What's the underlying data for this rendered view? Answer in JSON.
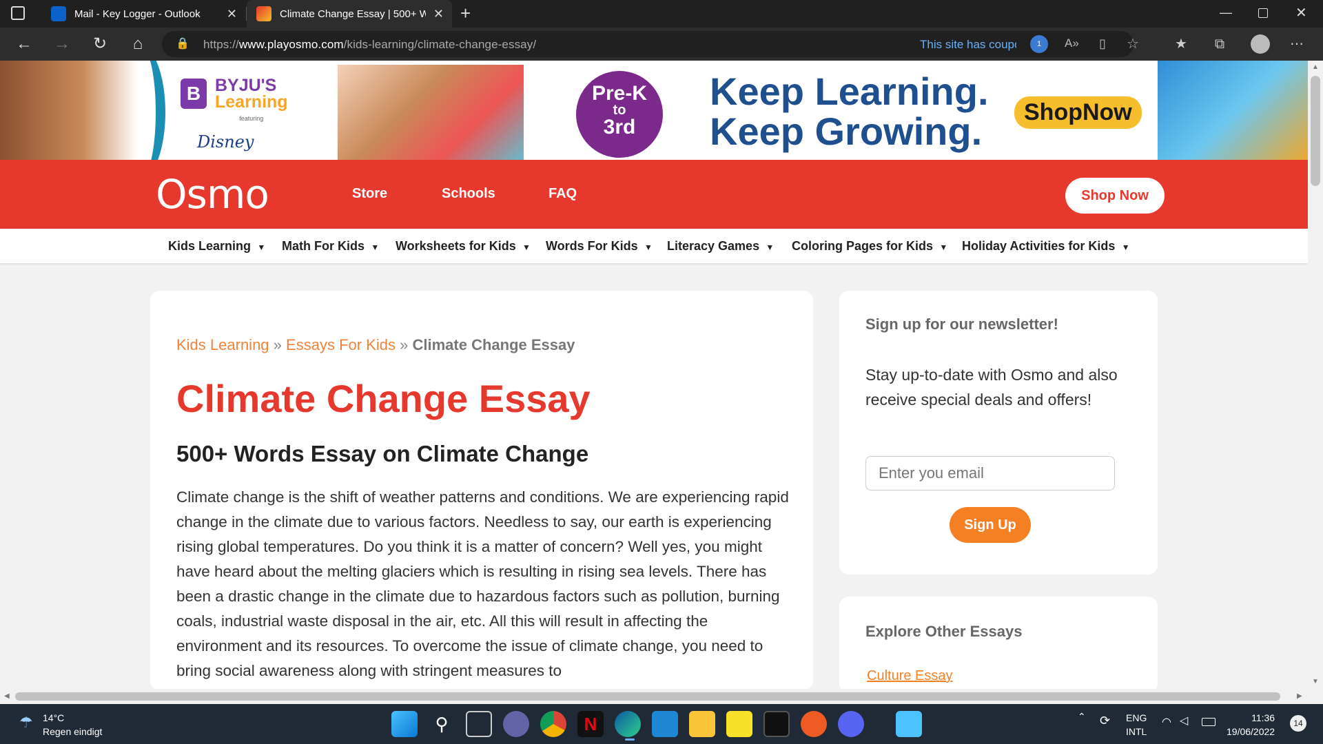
{
  "browser": {
    "tabs": [
      {
        "title": "Mail - Key Logger - Outlook"
      },
      {
        "title": "Climate Change Essay | 500+ Wo"
      }
    ],
    "url_prefix": "https://",
    "url_domain": "www.playosmo.com",
    "url_path": "/kids-learning/climate-change-essay/",
    "coupon_text": "This site has coupc",
    "coupon_count": "1"
  },
  "banner": {
    "brand": "BYJU'S",
    "brand_sub": "Learning",
    "featuring": "featuring",
    "disney": "Disney",
    "grade_top": "Pre-K",
    "grade_mid": "to",
    "grade_bottom": "3rd",
    "tagline1": "Keep Learning.",
    "tagline2": "Keep Growing.",
    "cta": "ShopNow"
  },
  "header": {
    "logo": "Osmo",
    "nav": [
      "Store",
      "Schools",
      "FAQ"
    ],
    "shop_now": "Shop Now"
  },
  "subnav": [
    "Kids Learning",
    "Math For Kids",
    "Worksheets for Kids",
    "Words For Kids",
    "Literacy Games",
    "Coloring Pages for Kids",
    "Holiday Activities for Kids"
  ],
  "article": {
    "breadcrumb": {
      "crumb1": "Kids Learning",
      "sep": "»",
      "crumb2": "Essays For Kids",
      "current": "Climate Change Essay"
    },
    "title": "Climate Change Essay",
    "subtitle": "500+ Words Essay on Climate Change",
    "body": "Climate change is the shift of weather patterns and conditions. We are experiencing rapid change in the climate due to various factors. Needless to say, our earth is experiencing rising global temperatures. Do you think it is a matter of concern? Well yes, you might have heard about the melting glaciers which is resulting in rising sea levels. There has been a drastic change in the climate due to hazardous factors such as pollution, burning coals, industrial waste disposal in the air, etc. All this will result in affecting the environment and its resources. To overcome the issue of climate change, you need to bring social awareness along with stringent measures to"
  },
  "newsletter": {
    "title": "Sign up for our newsletter!",
    "text": "Stay up-to-date with Osmo and also receive special deals and offers!",
    "email_placeholder": "Enter you email",
    "signup": "Sign Up"
  },
  "explore": {
    "title": "Explore Other Essays",
    "link": "Culture Essay"
  },
  "taskbar": {
    "temp": "14°C",
    "weather": "Regen eindigt",
    "lang_top": "ENG",
    "lang_bottom": "INTL",
    "time": "11:36",
    "date": "19/06/2022",
    "notifications": "14"
  }
}
